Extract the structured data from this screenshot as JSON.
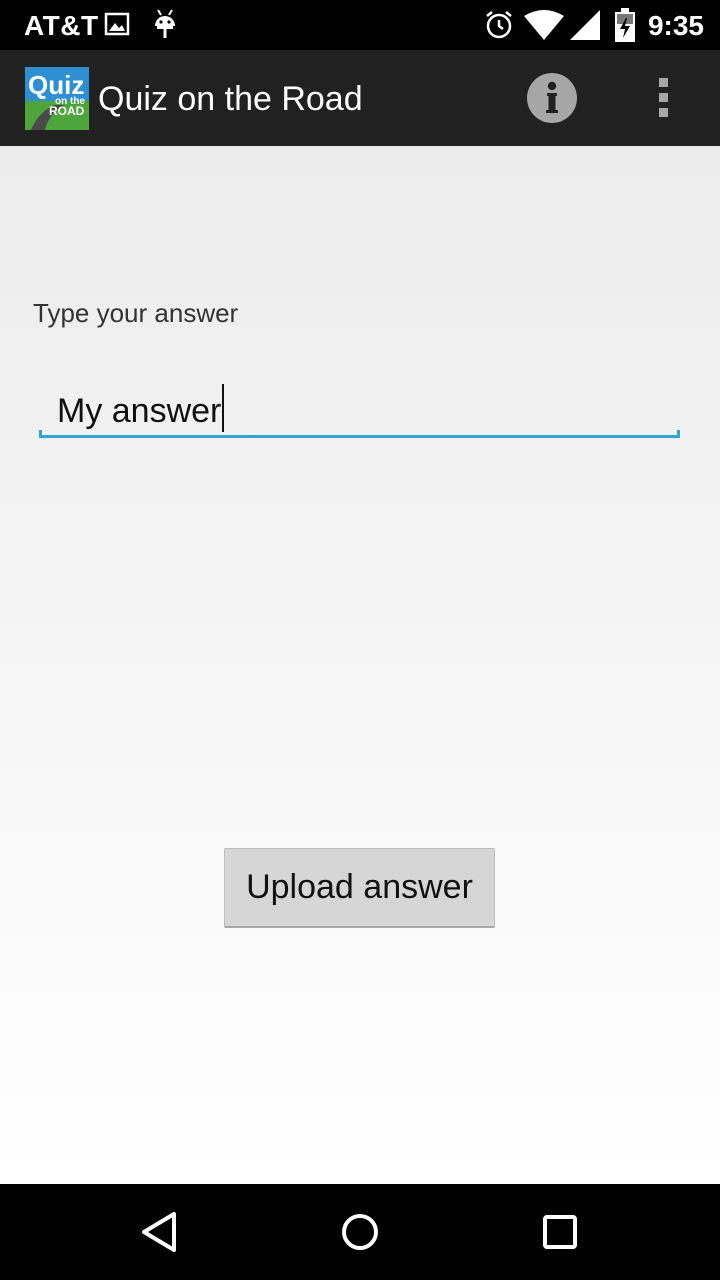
{
  "status_bar": {
    "carrier": "AT&T",
    "time": "9:35",
    "icons": [
      "image-icon",
      "android-icon",
      "alarm-icon",
      "wifi-icon",
      "signal-icon",
      "battery-charging-icon"
    ]
  },
  "action_bar": {
    "logo_text_top": "Quiz",
    "logo_text_mid": "on the",
    "logo_text_bottom": "ROAD",
    "title": "Quiz on the Road",
    "info_icon": "info-icon",
    "overflow_icon": "overflow-menu-icon"
  },
  "main": {
    "prompt_label": "Type your answer",
    "answer_value": "My answer",
    "upload_label": "Upload answer",
    "accent_color": "#33a3d4"
  },
  "nav_bar": {
    "icons": [
      "back-icon",
      "home-icon",
      "recents-icon"
    ]
  }
}
